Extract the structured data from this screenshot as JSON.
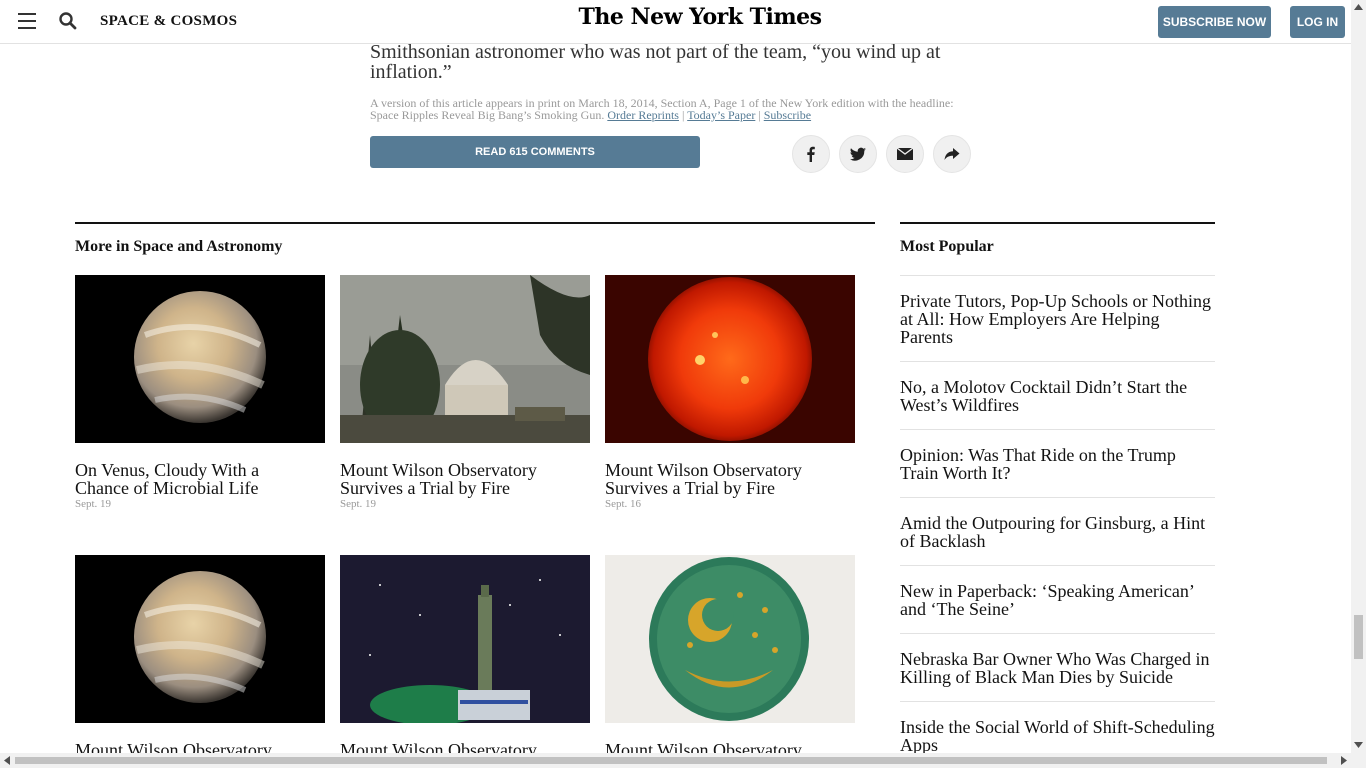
{
  "header": {
    "menu_icon": "hamburger-icon",
    "search_icon": "search-icon",
    "section": "SPACE & COSMOS",
    "logo": "The New York Times",
    "subscribe_label": "SUBSCRIBE NOW",
    "login_label": "LOG IN"
  },
  "article": {
    "body_tail_line1": "Smithsonian astronomer who was not part of the team, “you wind up at",
    "body_tail_line2": "inflation.”",
    "print_note_line1": "A version of this article appears in print on March 18, 2014, Section A, Page 1 of the New York edition with the headline:",
    "print_note_headline": "Space Ripples Reveal Big Bang’s Smoking Gun.",
    "order_reprints": "Order Reprints",
    "todays_paper": "Today’s Paper",
    "subscribe_link": "Subscribe",
    "separator": "|",
    "comments_label": "READ 615 COMMENTS",
    "share_icons": [
      "facebook-icon",
      "twitter-icon",
      "email-icon",
      "share-icon"
    ]
  },
  "more_in": {
    "heading": "More in Space and Astronomy",
    "cards": [
      {
        "title_line1": "On Venus, Cloudy With a",
        "title_line2": "Chance of Microbial Life",
        "date": "Sept. 19",
        "image": "venus"
      },
      {
        "title_line1": "Mount Wilson Observatory",
        "title_line2": "Survives a Trial by Fire",
        "date": "Sept. 19",
        "image": "observatory"
      },
      {
        "title_line1": "Mount Wilson Observatory",
        "title_line2": "Survives a Trial by Fire",
        "date": "Sept. 16",
        "image": "sun"
      },
      {
        "title_line1": "Mount Wilson Observatory",
        "title_line2": "",
        "date": "",
        "image": "venus"
      },
      {
        "title_line1": "Mount Wilson Observatory",
        "title_line2": "",
        "date": "",
        "image": "rocket"
      },
      {
        "title_line1": "Mount Wilson Observatory",
        "title_line2": "",
        "date": "",
        "image": "sky-disc"
      }
    ]
  },
  "most_popular": {
    "heading": "Most Popular",
    "items": [
      {
        "line1": "Private Tutors, Pop-Up Schools or Nothing",
        "line2": "at All: How Employers Are Helping",
        "line3": "Parents"
      },
      {
        "line1": "No, a Molotov Cocktail Didn’t Start the",
        "line2": "West’s Wildfires",
        "line3": ""
      },
      {
        "line1": "Opinion: Was That Ride on the Trump",
        "line2": "Train Worth It?",
        "line3": ""
      },
      {
        "line1": "Amid the Outpouring for Ginsburg, a Hint",
        "line2": "of Backlash",
        "line3": ""
      },
      {
        "line1": "New in Paperback: ‘Speaking American’",
        "line2": "and ‘The Seine’",
        "line3": ""
      },
      {
        "line1": "Nebraska Bar Owner Who Was Charged in",
        "line2": "Killing of Black Man Dies by Suicide",
        "line3": ""
      },
      {
        "line1": "Inside the Social World of Shift-Scheduling",
        "line2": "Apps",
        "line3": ""
      }
    ]
  },
  "colors": {
    "button_blue": "#567b95",
    "text": "#121212",
    "muted": "#999999"
  }
}
